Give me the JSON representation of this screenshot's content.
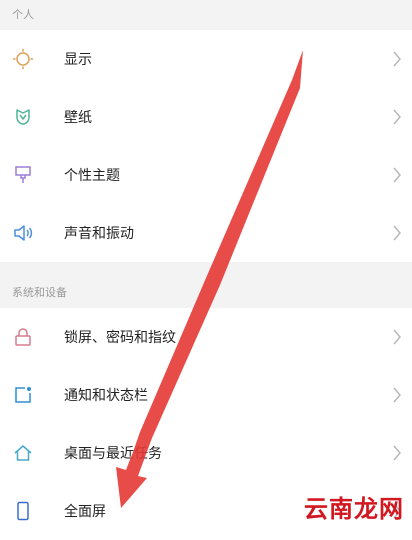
{
  "sections": {
    "personal_header": "个人",
    "system_header": "系统和设备"
  },
  "personal_items": [
    {
      "label": "显示",
      "icon": "sun-icon",
      "icon_color": "#d9a25a"
    },
    {
      "label": "壁纸",
      "icon": "wallpaper-icon",
      "icon_color": "#4fb39a"
    },
    {
      "label": "个性主题",
      "icon": "brush-icon",
      "icon_color": "#9b7fd6"
    },
    {
      "label": "声音和振动",
      "icon": "speaker-icon",
      "icon_color": "#4a8fdc"
    }
  ],
  "system_items": [
    {
      "label": "锁屏、密码和指纹",
      "icon": "lock-icon",
      "icon_color": "#d87a8e"
    },
    {
      "label": "通知和状态栏",
      "icon": "notification-icon",
      "icon_color": "#2f8fd6"
    },
    {
      "label": "桌面与最近任务",
      "icon": "home-icon",
      "icon_color": "#49a8c7"
    },
    {
      "label": "全面屏",
      "icon": "phone-icon",
      "icon_color": "#3a6fc9"
    }
  ],
  "overlay": {
    "watermark": "云南龙网",
    "arrow_color": "#e53935"
  }
}
